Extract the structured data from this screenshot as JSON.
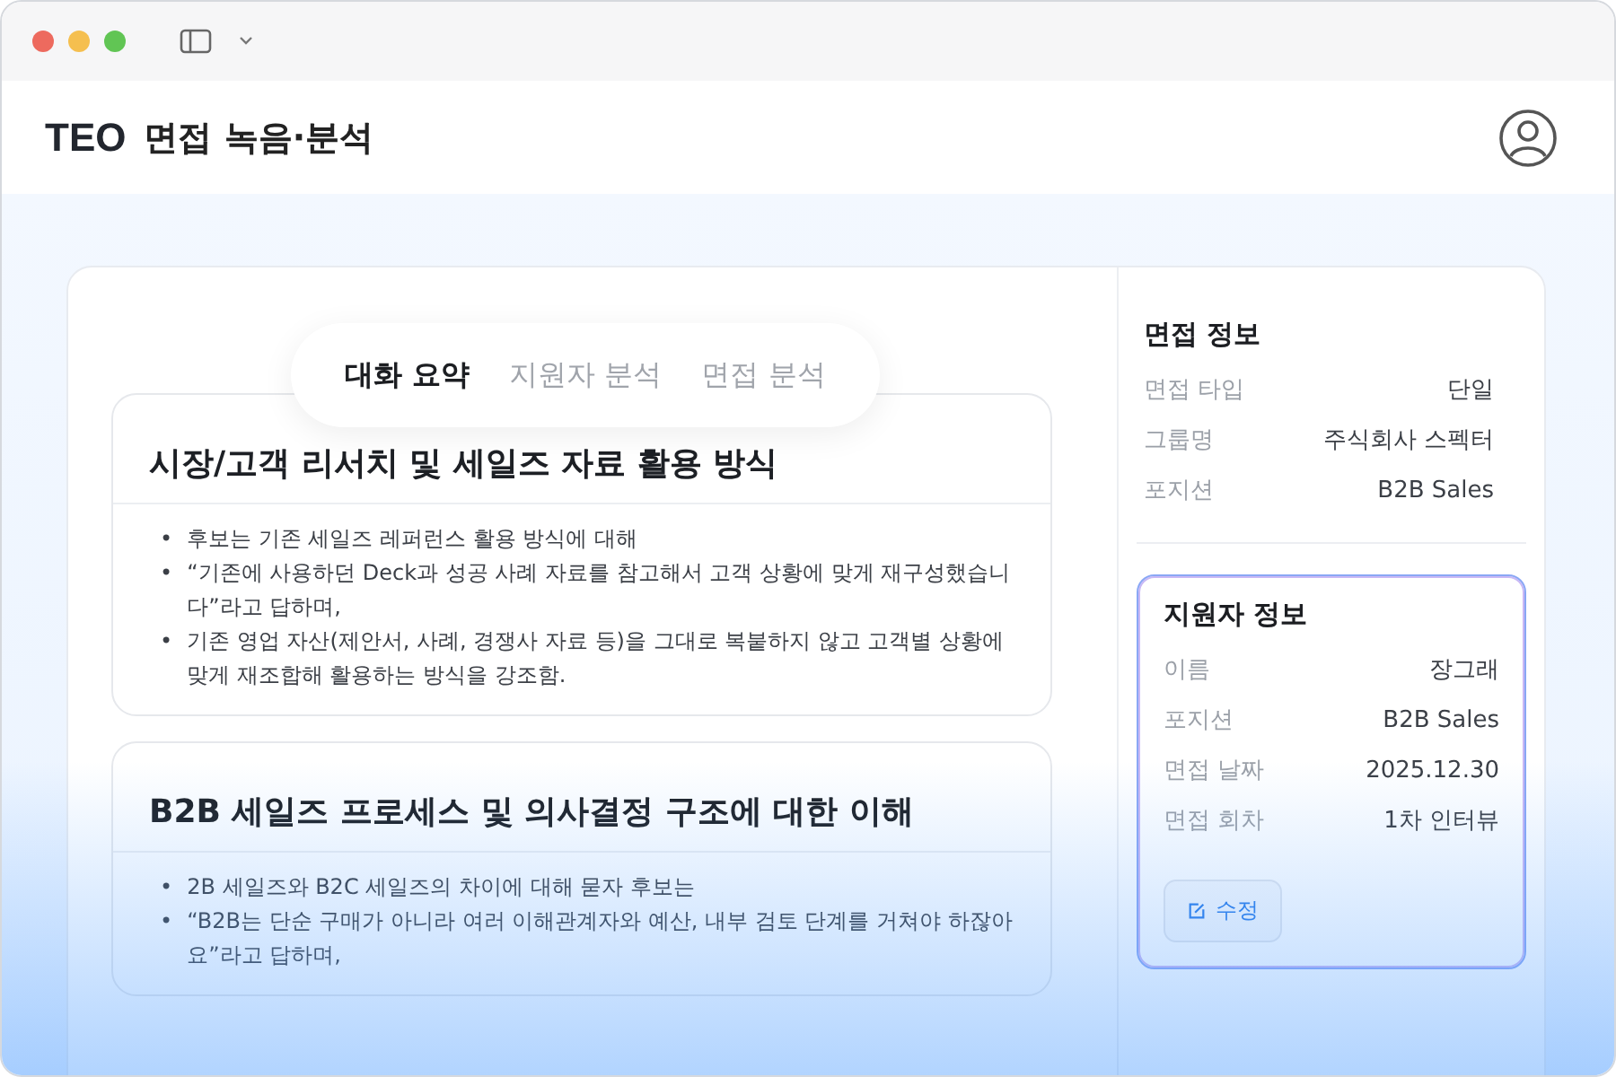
{
  "header": {
    "logo": "TEO",
    "title": "면접 녹음·분석"
  },
  "tabs": [
    {
      "label": "대화 요약",
      "selected": true
    },
    {
      "label": "지원자 분석",
      "selected": false
    },
    {
      "label": "면접 분석",
      "selected": false
    }
  ],
  "bullet_marker": "•",
  "sections": [
    {
      "title": "시장/고객 리서치 및 세일즈 자료 활용 방식",
      "bullets": [
        "후보는 기존 세일즈 레퍼런스 활용 방식에 대해",
        "“기존에 사용하던 Deck과 성공 사례 자료를 참고해서 고객 상황에 맞게 재구성했습니다”라고 답하며,",
        "기존 영업 자산(제안서, 사례, 경쟁사 자료 등)을 그대로 복붙하지 않고 고객별 상황에 맞게 재조합해 활용하는 방식을 강조함."
      ]
    },
    {
      "title": "B2B 세일즈 프로세스 및 의사결정 구조에 대한 이해",
      "bullets": [
        "2B 세일즈와 B2C 세일즈의 차이에 대해 묻자 후보는",
        "“B2B는 단순 구매가 아니라 여러 이해관계자와 예산, 내부 검토 단계를 거쳐야 하잖아요”라고 답하며,"
      ]
    }
  ],
  "interview_info": {
    "title": "면접 정보",
    "rows": [
      {
        "label": "면접 타입",
        "value": "단일"
      },
      {
        "label": "그룹명",
        "value": "주식회사 스펙터"
      },
      {
        "label": "포지션",
        "value": "B2B Sales"
      }
    ]
  },
  "applicant_info": {
    "title": "지원자 정보",
    "rows": [
      {
        "label": "이름",
        "value": "장그래"
      },
      {
        "label": "포지션",
        "value": "B2B Sales"
      },
      {
        "label": "면접 날짜",
        "value": "2025.12.30"
      },
      {
        "label": "면접 회차",
        "value": "1차 인터뷰"
      }
    ],
    "edit_button": "수정"
  }
}
